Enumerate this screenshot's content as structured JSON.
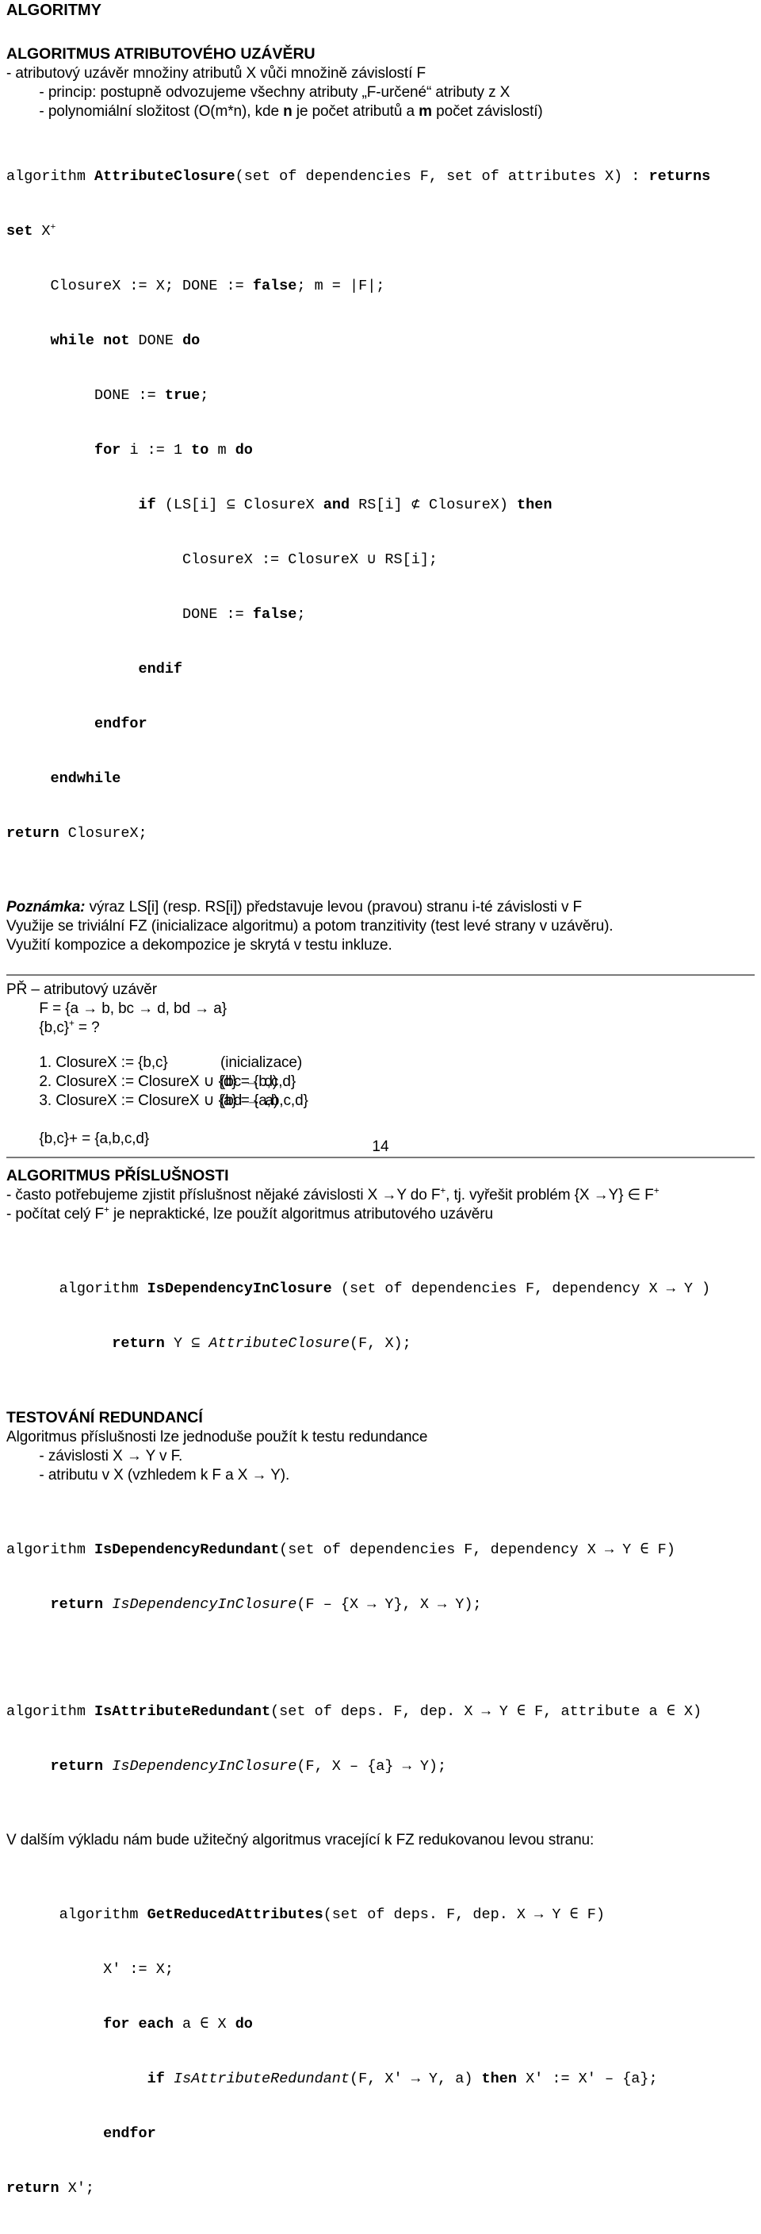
{
  "document": {
    "title": "ALGORITMY",
    "page_number": "14"
  },
  "section1": {
    "heading": "ALGORITMUS ATRIBUTOVÉHO UZÁVĚRU",
    "bullets": [
      "- atributový uzávěr množiny atributů X vůči množině závislostí F",
      "        - princip: postupně odvozujeme všechny atributy „F-určené“ atributy z X",
      "        - polynomiální složitost (O(m*n), kde "
    ],
    "bullet3_parts": {
      "a": "        - polynomiální složitost (O(m*n), kde ",
      "n": "n",
      "b": " je počet atributů a ",
      "m": "m",
      "c": " počet závislostí)"
    }
  },
  "algorithm1": {
    "line1_a": "algorithm ",
    "line1_name": "AttributeClosure",
    "line1_b": "(set of dependencies F, set of attributes X) : ",
    "line1_returns": "returns",
    "line2_set": "set",
    "line2_x": " X",
    "line2_sup": "+",
    "line3_a": "     ClosureX := X; DONE := ",
    "line3_false": "false",
    "line3_b": "; m = |F|;",
    "line4_a": "     ",
    "line4_b": "while not",
    "line4_c": " DONE ",
    "line4_d": "do",
    "line5_a": "          DONE := ",
    "line5_true": "true",
    "line5_b": ";",
    "line6_a": "          ",
    "line6_for": "for",
    "line6_b": " i := 1 ",
    "line6_to": "to",
    "line6_c": " m ",
    "line6_do": "do",
    "line7_a": "               ",
    "line7_if": "if",
    "line7_b": " (LS[i] ⊆ ClosureX ",
    "line7_and": "and",
    "line7_c": " RS[i] ⊄ ClosureX) ",
    "line7_then": "then",
    "line8": "                    ClosureX := ClosureX ∪ RS[i];",
    "line9_a": "                    DONE := ",
    "line9_false": "false",
    "line9_b": ";",
    "line10": "               endif",
    "line11": "          endfor",
    "line12": "     endwhile",
    "line13_ret": "return",
    "line13_b": " ClosureX;"
  },
  "note": {
    "label": "Poznámka:",
    "line1": " výraz LS[i] (resp. RS[i]) představuje levou (pravou) stranu i-té závislosti v F",
    "line2": "Využije se triviální FZ (inicializace algoritmu) a potom tranzitivity (test levé strany v uzávěru).",
    "line3": "Využití kompozice a dekompozice je skrytá v testu inkluze."
  },
  "example": {
    "heading": "PŘ – atributový uzávěr",
    "given": "        F = {a → b, bc → d, bd → a}",
    "question_a": "        {b,c}",
    "question_sup": "+",
    "question_b": " = ?",
    "steps": [
      {
        "text": "        1. ClosureX := {b,c}",
        "comment": "(inicializace)"
      },
      {
        "text": "        2. ClosureX := ClosureX ∪ {d} = {b,c,d}",
        "comment": "(bc → d)"
      },
      {
        "text": "        3. ClosureX := ClosureX ∪ {a} = {a,b,c,d}",
        "comment": "(bd → a)"
      }
    ],
    "result": "        {b,c}+ = {a,b,c,d}"
  },
  "section2": {
    "heading": "ALGORITMUS PŘÍSLUŠNOSTI",
    "line1_a": "- často potřebujeme zjistit příslušnost nějaké závislosti X →Y do F",
    "line1_sup": "+",
    "line1_b": ", tj. vyřešit problém {X →Y} ∈ F",
    "line1_sup2": "+",
    "line2_a": "- počítat celý F",
    "line2_sup": "+",
    "line2_b": " je nepraktické, lze použít algoritmus atributového uzávěru"
  },
  "algorithm2": {
    "line1_a": "      algorithm ",
    "line1_name": "IsDependencyInClosure",
    "line1_b": " (set of dependencies F, dependency X → Y )",
    "line2_a": "            ",
    "line2_ret": "return",
    "line2_b": " Y ⊆ ",
    "line2_call": "AttributeClosure",
    "line2_c": "(F, X);"
  },
  "section3": {
    "heading": "TESTOVÁNÍ REDUNDANCÍ",
    "line1": "Algoritmus příslušnosti lze jednoduše použít k testu redundance",
    "line2": "        - závislosti X → Y v F.",
    "line3": "        - atributu v X (vzhledem k F a X → Y)."
  },
  "algorithm3": {
    "line1_a": "algorithm ",
    "line1_name": "IsDependencyRedundant",
    "line1_b": "(set of dependencies F, dependency X → Y ∈ F)",
    "line2_a": "     ",
    "line2_ret": "return",
    "line2_b": " ",
    "line2_call": "IsDependencyInClosure",
    "line2_c": "(F – {X → Y}, X → Y);"
  },
  "algorithm4": {
    "line1_a": "algorithm ",
    "line1_name": "IsAttributeRedundant",
    "line1_b": "(set of deps. F, dep. X → Y ∈ F, attribute a ∈ X)",
    "line2_a": "     ",
    "line2_ret": "return",
    "line2_b": " ",
    "line2_call": "IsDependencyInClosure",
    "line2_c": "(F, X – {a} → Y);"
  },
  "outro": {
    "text": "V dalším výkladu nám bude užitečný algoritmus vracející k FZ redukovanou levou stranu:"
  },
  "algorithm5": {
    "line1_a": "      algorithm ",
    "line1_name": "GetReducedAttributes",
    "line1_b": "(set of deps. F, dep. X → Y ∈ F)",
    "line2": "           X′ := X;",
    "line3_a": "           ",
    "line3_for": "for each",
    "line3_b": " a ∈ X ",
    "line3_do": "do",
    "line4_a": "                ",
    "line4_if": "if",
    "line4_b": " ",
    "line4_call": "IsAttributeRedundant",
    "line4_c": "(F, X′ → Y, a) ",
    "line4_then": "then",
    "line4_d": " X′ := X′ – {a};",
    "line5": "           endfor",
    "line6_ret": "return",
    "line6_b": " X′;"
  }
}
